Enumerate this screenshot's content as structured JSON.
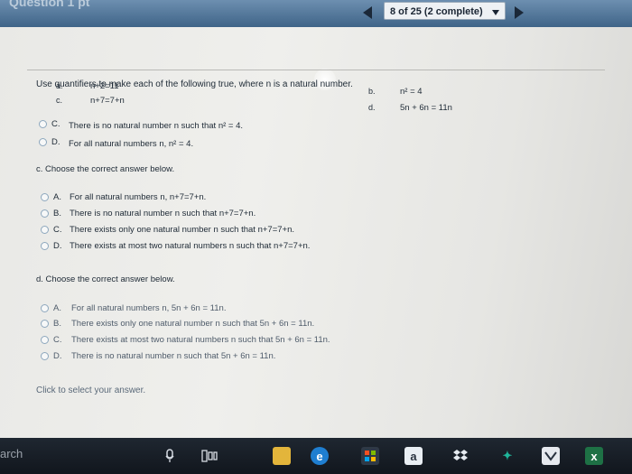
{
  "header": {
    "partial_title": "Question 1 pt",
    "counter_text": "8 of 25 (2 complete)"
  },
  "question": {
    "prompt": "Use quantifiers to make each of the following true, where n is a natural number.",
    "statements": [
      {
        "letter": "a.",
        "text": "n+2=11"
      },
      {
        "letter": "b.",
        "text": "n² = 4"
      },
      {
        "letter": "c.",
        "text": "n+7=7+n"
      },
      {
        "letter": "d.",
        "text": "5n + 6n = 11n"
      }
    ]
  },
  "b_options_visible": [
    {
      "letter": "C.",
      "text": "There is no natural number n such that n² = 4."
    },
    {
      "letter": "D.",
      "text": "For all natural numbers n, n² = 4."
    }
  ],
  "part_c": {
    "label": "c. Choose the correct answer below.",
    "options": [
      {
        "letter": "A.",
        "text": "For all natural numbers n, n+7=7+n."
      },
      {
        "letter": "B.",
        "text": "There is no natural number n such that n+7=7+n."
      },
      {
        "letter": "C.",
        "text": "There exists only one natural number n such that n+7=7+n."
      },
      {
        "letter": "D.",
        "text": "There exists at most two natural numbers n such that n+7=7+n."
      }
    ]
  },
  "part_d": {
    "label": "d. Choose the correct answer below.",
    "options": [
      {
        "letter": "A.",
        "text": "For all natural numbers n, 5n + 6n = 11n."
      },
      {
        "letter": "B.",
        "text": "There exists only one natural number n such that 5n + 6n = 11n."
      },
      {
        "letter": "C.",
        "text": "There exists at most two natural numbers n such that 5n + 6n = 11n."
      },
      {
        "letter": "D.",
        "text": "There is no natural number n such that 5n + 6n = 11n."
      }
    ]
  },
  "footer_hint": "Click to select your answer.",
  "taskbar": {
    "search_fragment": "arch",
    "letter_icon": "a",
    "icons": [
      "microphone-icon",
      "task-view-icon",
      "file-explorer-icon",
      "edge-icon",
      "store-icon",
      "word-icon",
      "dropbox-icon",
      "app-icon",
      "vs-icon",
      "excel-icon"
    ]
  },
  "colors": {
    "header_bar": "#3f6488",
    "radio_border": "#8da7bd",
    "taskbar": "#11161d"
  }
}
